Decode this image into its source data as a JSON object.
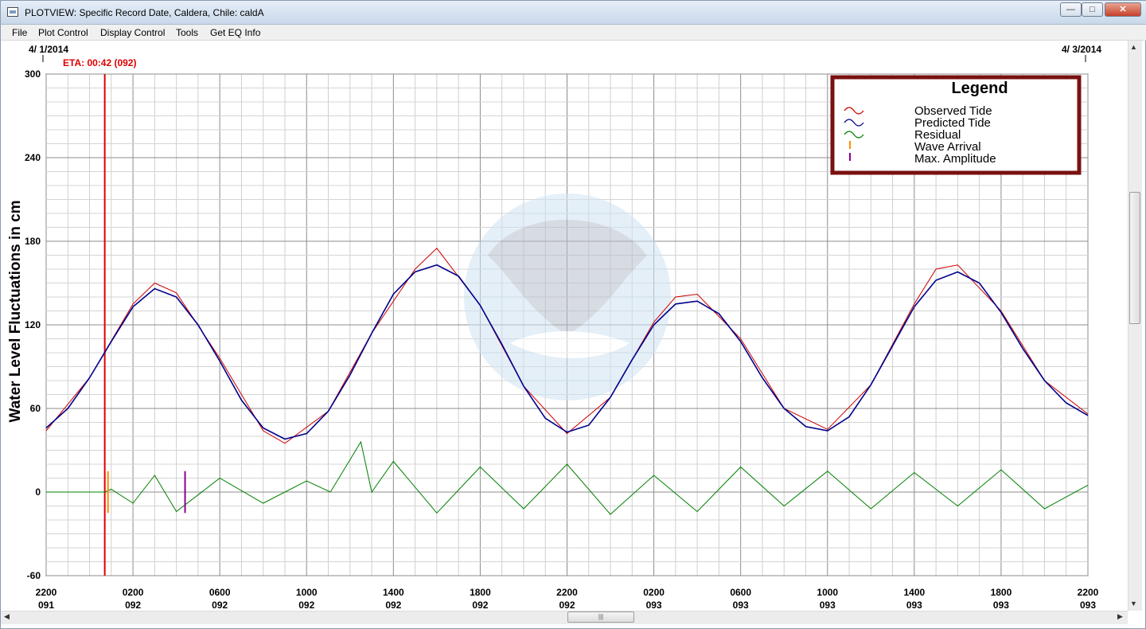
{
  "window": {
    "title": "PLOTVIEW: Specific Record Date, Caldera, Chile: caldA"
  },
  "menu": [
    "File",
    "Plot Control",
    "Display Control",
    "Tools",
    "Get EQ Info"
  ],
  "colors": {
    "observed": "#cc0000",
    "predicted": "#00008b",
    "residual": "#008000",
    "wave_arrival": "#ff8c00",
    "max_amplitude": "#8b008b",
    "eta_line": "#dd0000",
    "legend_border": "#7a1010"
  },
  "chart_data": {
    "type": "line",
    "ylabel": "Water Level Fluctuations in cm",
    "ylim": [
      -60,
      300
    ],
    "y_ticks": [
      "300",
      "240",
      "180",
      "120",
      "60",
      "0",
      "-60"
    ],
    "xlim": [
      0,
      48
    ],
    "x_ticks": [
      {
        "time": "2200",
        "day": "091"
      },
      {
        "time": "0200",
        "day": "092"
      },
      {
        "time": "0600",
        "day": "092"
      },
      {
        "time": "1000",
        "day": "092"
      },
      {
        "time": "1400",
        "day": "092"
      },
      {
        "time": "1800",
        "day": "092"
      },
      {
        "time": "2200",
        "day": "092"
      },
      {
        "time": "0200",
        "day": "093"
      },
      {
        "time": "0600",
        "day": "093"
      },
      {
        "time": "1000",
        "day": "093"
      },
      {
        "time": "1400",
        "day": "093"
      },
      {
        "time": "1800",
        "day": "093"
      },
      {
        "time": "2200",
        "day": "093"
      }
    ],
    "date_start": "4/ 1/2014",
    "date_end": "4/ 3/2014",
    "eta_label": "ETA: 00:42 (092)",
    "grid": true,
    "legend": {
      "title": "Legend",
      "placement": "top-right",
      "items": [
        "Observed Tide",
        "Predicted Tide",
        "Residual",
        "Wave Arrival",
        "Max. Amplitude"
      ]
    },
    "series": [
      {
        "name": "Predicted Tide",
        "x": [
          0,
          1,
          2,
          3,
          4,
          5,
          6,
          7,
          8,
          9,
          10,
          11,
          12,
          13,
          14,
          15,
          16,
          17,
          18,
          19,
          20,
          21,
          22,
          23,
          24,
          25,
          26,
          27,
          28,
          29,
          30,
          31,
          32,
          33,
          34,
          35,
          36,
          37,
          38,
          39,
          40,
          41,
          42,
          43,
          44,
          45,
          46,
          47,
          48
        ],
        "y": [
          46,
          60,
          82,
          108,
          133,
          146,
          140,
          120,
          94,
          66,
          46,
          38,
          42,
          58,
          84,
          114,
          142,
          158,
          163,
          155,
          134,
          106,
          76,
          53,
          43,
          48,
          68,
          95,
          120,
          135,
          137,
          128,
          108,
          82,
          60,
          47,
          44,
          54,
          77,
          105,
          133,
          152,
          158,
          150,
          129,
          103,
          80,
          64,
          55
        ]
      },
      {
        "name": "Observed Tide",
        "x": [
          0,
          2,
          4,
          5,
          6,
          8,
          10,
          11,
          13,
          15,
          17,
          18,
          20,
          22,
          24,
          26,
          28,
          29,
          30,
          32,
          34,
          36,
          38,
          40,
          41,
          42,
          44,
          46,
          48
        ],
        "y": [
          44,
          82,
          135,
          150,
          143,
          96,
          44,
          35,
          58,
          114,
          160,
          175,
          134,
          76,
          42,
          68,
          122,
          140,
          142,
          110,
          60,
          45,
          77,
          135,
          160,
          163,
          130,
          80,
          56
        ]
      },
      {
        "name": "Residual",
        "x": [
          0,
          2,
          2.7,
          3,
          4,
          5,
          6,
          8,
          10,
          12,
          13.1,
          14.5,
          15,
          16,
          18,
          20,
          22,
          24,
          26,
          28,
          30,
          32,
          34,
          36,
          38,
          40,
          42,
          44,
          46,
          48
        ],
        "y": [
          0,
          0,
          0,
          2,
          -8,
          12,
          -14,
          10,
          -8,
          8,
          0,
          36,
          0,
          22,
          -15,
          18,
          -12,
          20,
          -16,
          12,
          -14,
          18,
          -10,
          15,
          -12,
          14,
          -10,
          16,
          -12,
          5
        ]
      }
    ],
    "markers": [
      {
        "name": "Wave Arrival",
        "x": 2.85,
        "y_low": -15,
        "y_high": 15
      },
      {
        "name": "Max. Amplitude",
        "x": 6.4,
        "y_low": -15,
        "y_high": 15
      }
    ],
    "eta_x": 2.7
  }
}
